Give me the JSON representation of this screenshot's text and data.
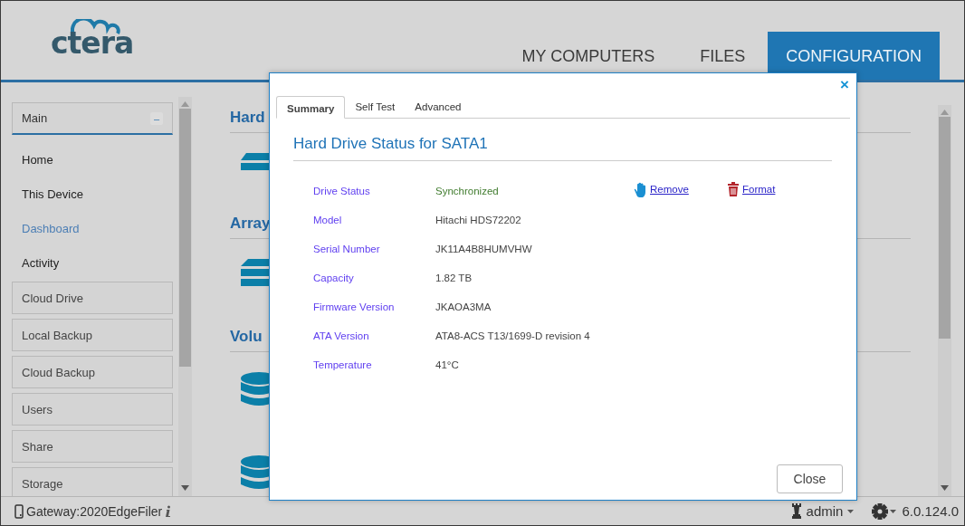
{
  "header": {
    "logo": "ctera",
    "nav": [
      {
        "label": "MY COMPUTERS",
        "selected": false
      },
      {
        "label": "FILES",
        "selected": false
      },
      {
        "label": "CONFIGURATION",
        "selected": true
      }
    ]
  },
  "sidebar": {
    "section": {
      "label": "Main",
      "toggle": "–"
    },
    "links": [
      {
        "label": "Home",
        "selected": false
      },
      {
        "label": "This Device",
        "selected": false
      },
      {
        "label": "Dashboard",
        "selected": true
      },
      {
        "label": "Activity",
        "selected": false
      }
    ],
    "groups": [
      "Cloud Drive",
      "Local Backup",
      "Cloud Backup",
      "Users",
      "Share",
      "Storage"
    ]
  },
  "content": {
    "sections": [
      {
        "title": "Hard",
        "kind": "drive"
      },
      {
        "title": "Array",
        "kind": "array"
      },
      {
        "title": "Volu",
        "kind": "volume"
      }
    ]
  },
  "dialog": {
    "close": "×",
    "tabs": [
      {
        "label": "Summary",
        "selected": true
      },
      {
        "label": "Self Test",
        "selected": false
      },
      {
        "label": "Advanced",
        "selected": false
      }
    ],
    "title": "Hard Drive Status for SATA1",
    "fields": [
      {
        "label": "Drive Status",
        "value": "Synchronized",
        "kind": "status"
      },
      {
        "label": "Model",
        "value": "Hitachi HDS72202",
        "kind": "text"
      },
      {
        "label": "Serial Number",
        "value": "JK11A4B8HUMVHW",
        "kind": "text"
      },
      {
        "label": "Capacity",
        "value": "1.82 TB",
        "kind": "text"
      },
      {
        "label": "Firmware Version",
        "value": "JKAOA3MA",
        "kind": "text"
      },
      {
        "label": "ATA Version",
        "value": "ATA8-ACS T13/1699-D revision 4",
        "kind": "text"
      },
      {
        "label": "Temperature",
        "value": "41°C",
        "kind": "text"
      }
    ],
    "actions": [
      {
        "label": "Remove",
        "kind": "remove"
      },
      {
        "label": "Format",
        "kind": "format"
      }
    ],
    "button": "Close"
  },
  "status_bar": {
    "gateway": "Gateway:2020EdgeFiler",
    "user": "admin",
    "version": "6.0.124.0"
  }
}
